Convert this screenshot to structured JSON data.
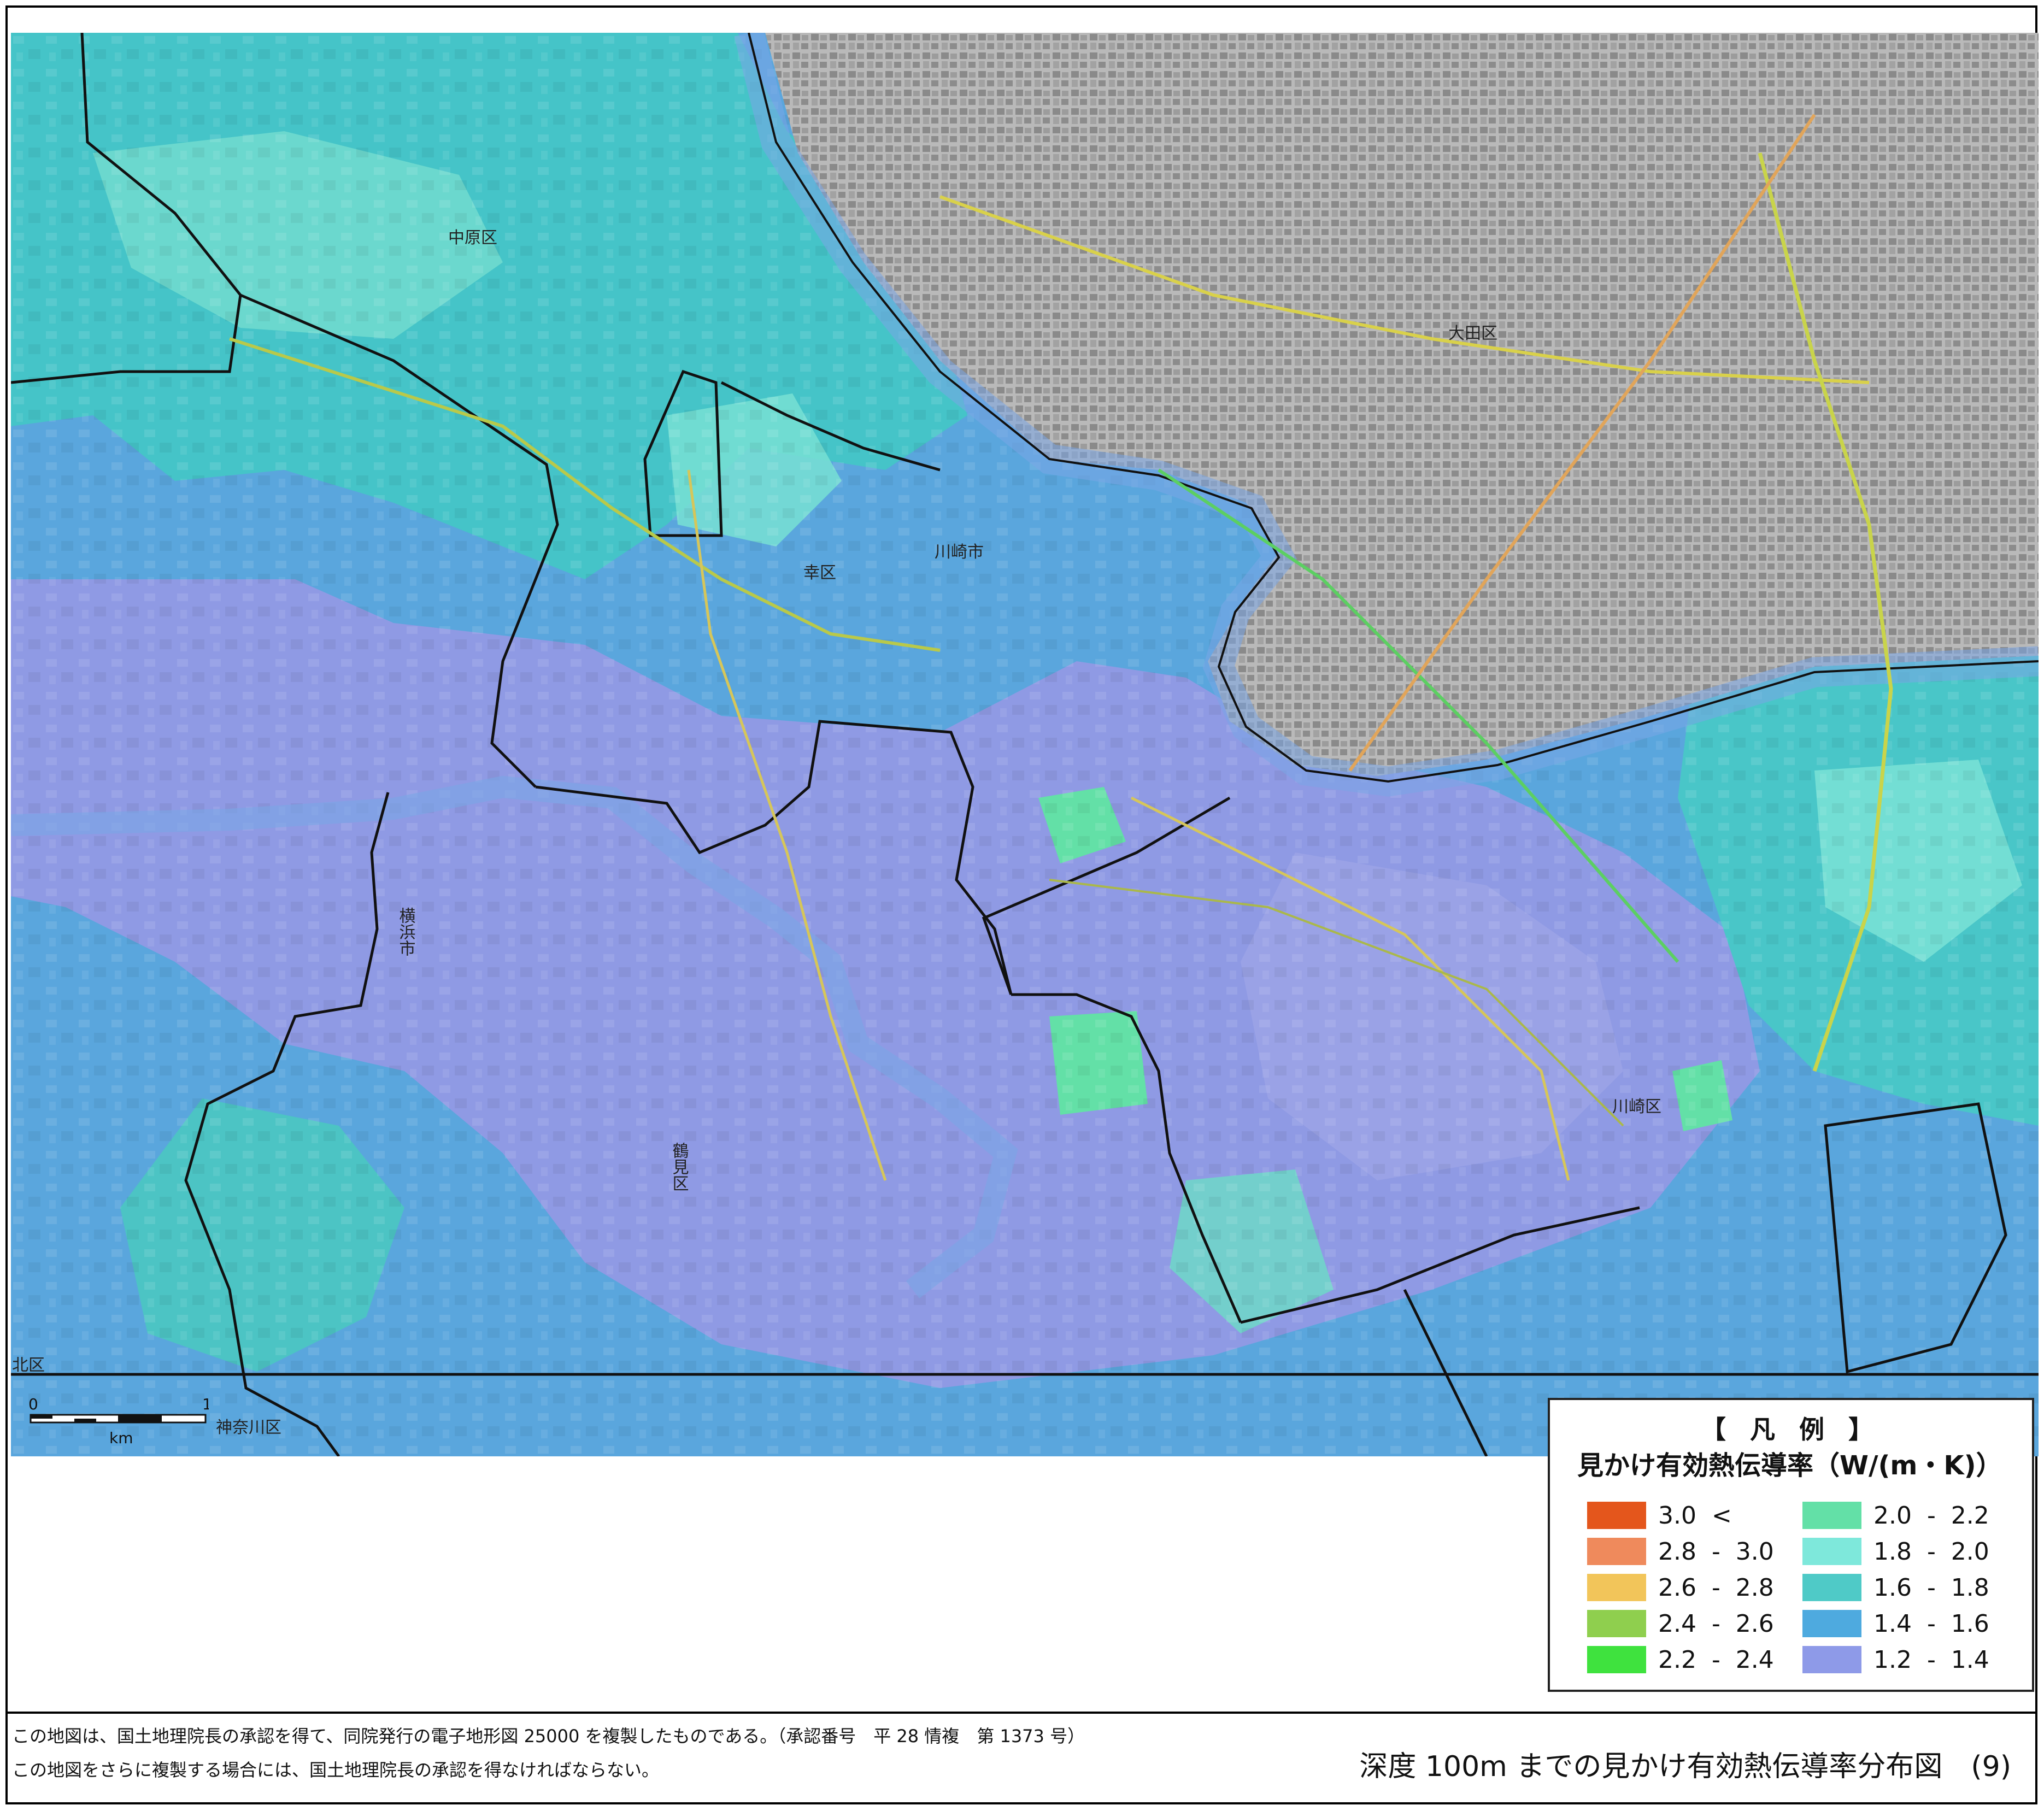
{
  "map": {
    "place_labels": [
      {
        "id": "nakahara",
        "text": "中原区"
      },
      {
        "id": "ota",
        "text": "大田区"
      },
      {
        "id": "saiwai",
        "text": "幸区"
      },
      {
        "id": "kawasaki_city",
        "text": "川崎市"
      },
      {
        "id": "yokohama_city",
        "text": "横浜市"
      },
      {
        "id": "tsurumi",
        "text": "鶴見区"
      },
      {
        "id": "kawasaki_ward",
        "text": "川崎区"
      },
      {
        "id": "kanagawa",
        "text": "神奈川区"
      },
      {
        "id": "kita",
        "text": "北区"
      }
    ],
    "scale_bar": {
      "start": "0",
      "end": "1",
      "unit": "km"
    }
  },
  "legend": {
    "title": "【 凡 例 】",
    "subtitle": "見かけ有効熱伝導率（W/(m・K)）",
    "classes": [
      {
        "label": "3.0  <",
        "color": "#e4561c"
      },
      {
        "label": "2.8  -  3.0",
        "color": "#ef8a5c"
      },
      {
        "label": "2.6  -  2.8",
        "color": "#f2c55a"
      },
      {
        "label": "2.4  -  2.6",
        "color": "#8fcf4e"
      },
      {
        "label": "2.2  -  2.4",
        "color": "#3fe23e"
      },
      {
        "label": "2.0  -  2.2",
        "color": "#63e0a7"
      },
      {
        "label": "1.8  -  2.0",
        "color": "#7ee8db"
      },
      {
        "label": "1.6  -  1.8",
        "color": "#4fcac7"
      },
      {
        "label": "1.4  -  1.6",
        "color": "#4eaadf"
      },
      {
        "label": "1.2  -  1.4",
        "color": "#8e9ae8"
      }
    ]
  },
  "footer": {
    "note1": "この地図は、国土地理院長の承認を得て、同院発行の電子地形図 25000 を複製したものである。（承認番号　平 28 情複　第 1373 号）",
    "note2": "この地図をさらに複製する場合には、国土地理院長の承認を得なければならない。",
    "sheet_title": "深度 100m までの見かけ有効熱伝導率分布図　(9)"
  }
}
